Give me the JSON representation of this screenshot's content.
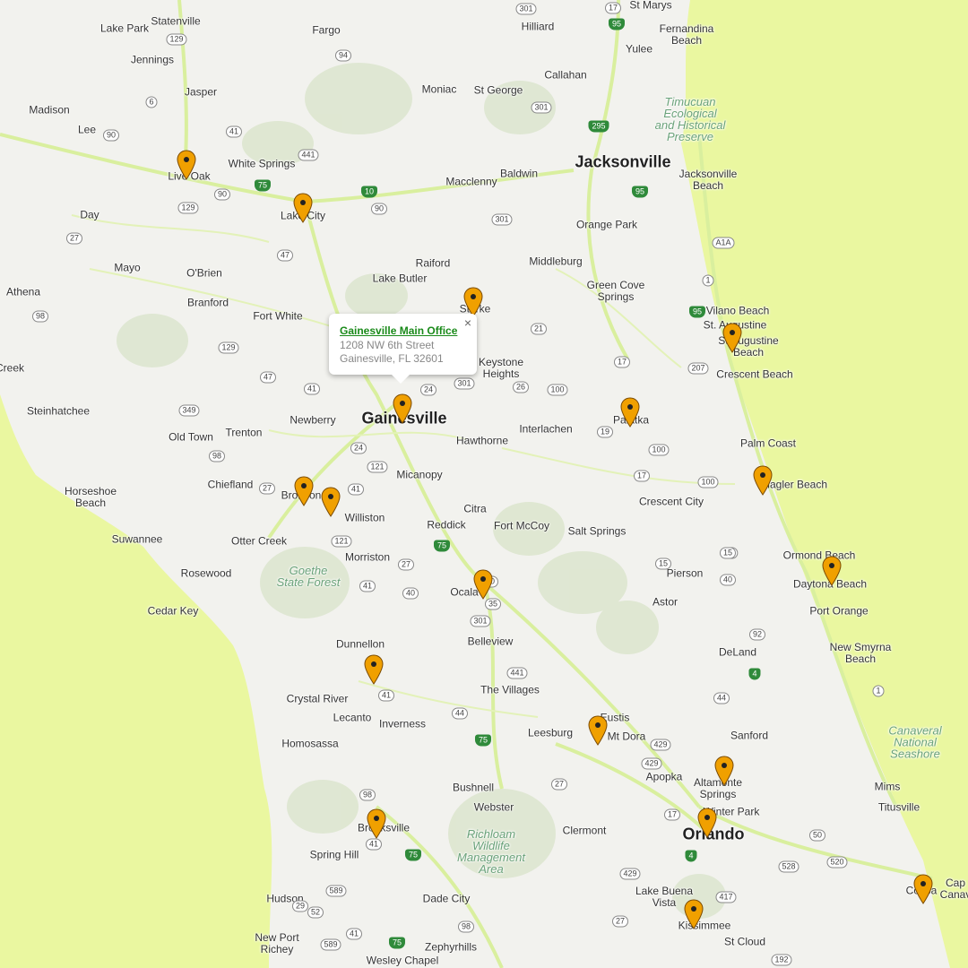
{
  "colors": {
    "land": "#f2f2ee",
    "water": "#eaf7a0",
    "green": "#dfe8d0",
    "road": "#d9ef9e",
    "pin": "#f0a000"
  },
  "popup": {
    "title": "Gainesville Main Office",
    "line1": "1208 NW 6th Street",
    "line2": "Gainesville, FL 32601",
    "close": "×"
  },
  "big_cities": [
    "Jacksonville",
    "Gainesville",
    "Orlando"
  ],
  "labels": [
    "Lake Park",
    "Statenville",
    "Fargo",
    "Hilliard",
    "St Marys",
    "Jennings",
    "Fernandina Beach",
    "Yulee",
    "Jasper",
    "Callahan",
    "Moniac",
    "St George",
    "Madison",
    "Timucuan Ecological and Historical Preserve",
    "Lee",
    "Live Oak",
    "White Springs",
    "Baldwin",
    "Macclenny",
    "Jacksonville Beach",
    "Day",
    "Lake City",
    "Orange Park",
    "Mayo",
    "O'Brien",
    "Raiford",
    "Middleburg",
    "Athena",
    "Branford",
    "Lake Butler",
    "Starke",
    "Green Cove Springs",
    "Vilano Beach",
    "St. Augustine",
    "St Augustine Beach",
    "Fort White",
    "Keystone Heights",
    "Crescent Beach",
    "Creek",
    "Steinhatchee",
    "Newberry",
    "Interlachen",
    "Palatka",
    "Old Town",
    "Trenton",
    "Hawthorne",
    "Palm Coast",
    "Chiefland",
    "Micanopy",
    "Flagler Beach",
    "Horseshoe Beach",
    "Bronson",
    "Williston",
    "Crescent City",
    "Citra",
    "Reddick",
    "Fort McCoy",
    "Salt Springs",
    "Suwannee",
    "Otter Creek",
    "Morriston",
    "Ormond Beach",
    "Rosewood",
    "Goethe State Forest",
    "Ocala",
    "Pierson",
    "Daytona Beach",
    "Cedar Key",
    "Astor",
    "Port Orange",
    "Belleview",
    "Dunnellon",
    "DeLand",
    "New Smyrna Beach",
    "The Villages",
    "Crystal River",
    "Lecanto",
    "Inverness",
    "Eustis",
    "Leesburg",
    "Mt Dora",
    "Sanford",
    "Homosassa",
    "Canaveral National Seashore",
    "Apopka",
    "Altamonte Springs",
    "Mims",
    "Bushnell",
    "Brooksville",
    "Webster",
    "Winter Park",
    "Titusville",
    "Clermont",
    "Richloam Wildlife Management Area",
    "Spring Hill",
    "Hudson",
    "Dade City",
    "Lake Buena Vista",
    "Cocoa",
    "Kissimmee",
    "New Port Richey",
    "St Cloud",
    "Zephyrhills",
    "Wesley Chapel",
    "Cap Canav"
  ],
  "pins": [
    "Live Oak",
    "Lake City",
    "Starke",
    "St Augustine",
    "Gainesville",
    "Palatka",
    "Flagler Beach",
    "Bronson",
    "Williston",
    "Ormond Beach",
    "Ocala",
    "Dunnellon",
    "Eustis",
    "Altamonte Springs",
    "Brooksville",
    "Winter Park",
    "Cocoa",
    "Kissimmee"
  ]
}
